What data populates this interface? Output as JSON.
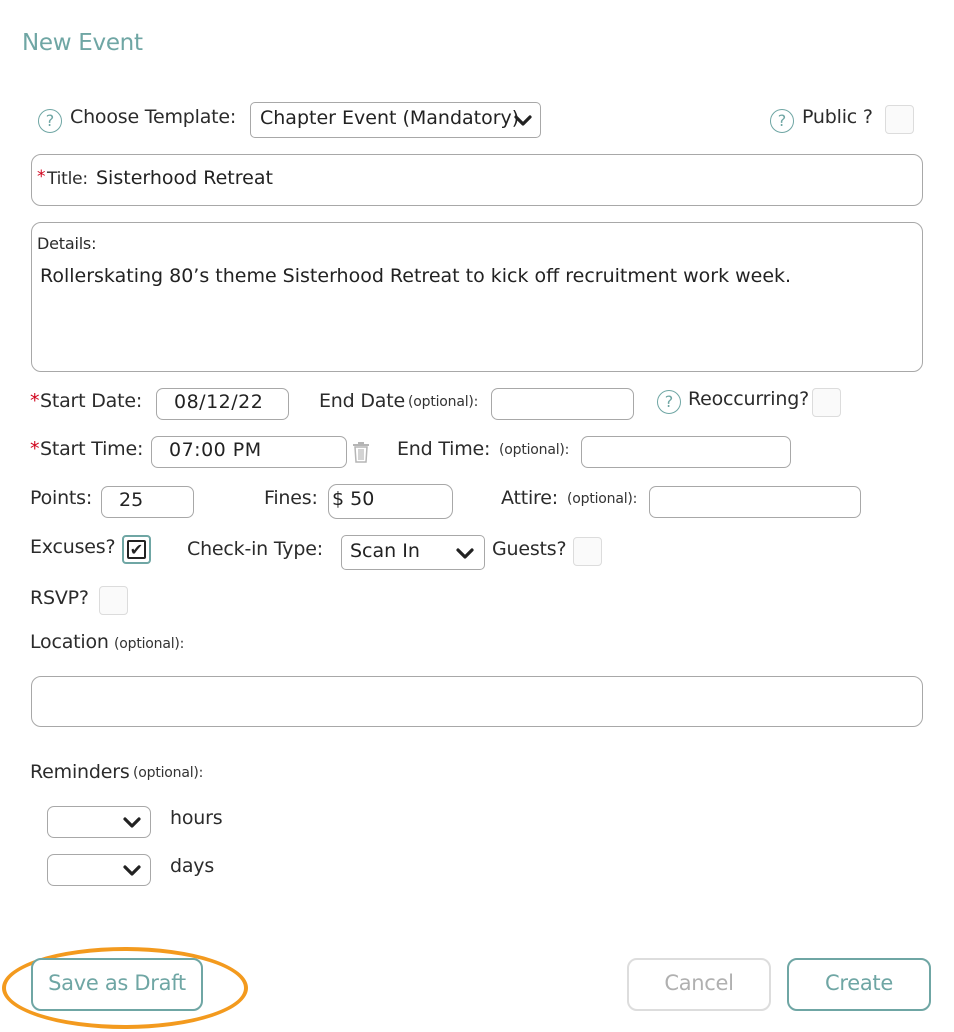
{
  "page": {
    "title": "New Event"
  },
  "template": {
    "label": "Choose Template:",
    "value": "Chapter Event (Mandatory)"
  },
  "public": {
    "label": "Public ?",
    "checked": false
  },
  "title_field": {
    "required_mark": "*",
    "label": "Title:",
    "value": "Sisterhood Retreat"
  },
  "details": {
    "label": "Details:",
    "value": "Rollerskating 80’s theme Sisterhood Retreat to kick off recruitment work week."
  },
  "start_date": {
    "required_mark": "*",
    "label": "Start Date:",
    "value": "08/12/22"
  },
  "end_date": {
    "label": "End Date",
    "optional": "(optional):",
    "value": ""
  },
  "reoccurring": {
    "label": "Reoccurring?",
    "checked": false
  },
  "start_time": {
    "required_mark": "*",
    "label": "Start Time:",
    "value": "07:00 PM"
  },
  "end_time": {
    "label": "End Time:",
    "optional": "(optional):",
    "value": ""
  },
  "points": {
    "label": "Points:",
    "value": "25"
  },
  "fines": {
    "label": "Fines:",
    "value": "$ 50"
  },
  "attire": {
    "label": "Attire:",
    "optional": "(optional):",
    "value": ""
  },
  "excuses": {
    "label": "Excuses?",
    "checked": true,
    "check_glyph": "✔"
  },
  "checkin": {
    "label": "Check-in Type:",
    "value": "Scan In"
  },
  "guests": {
    "label": "Guests?",
    "checked": false
  },
  "rsvp": {
    "label": "RSVP?",
    "checked": false
  },
  "location": {
    "label": "Location",
    "optional": "(optional):",
    "value": ""
  },
  "reminders": {
    "label": "Reminders",
    "optional": "(optional):",
    "hours_label": "hours",
    "days_label": "days",
    "hours_value": "",
    "days_value": ""
  },
  "help_glyph": "?",
  "buttons": {
    "save_draft": "Save as Draft",
    "cancel": "Cancel",
    "create": "Create"
  },
  "colors": {
    "accent": "#6fa6a4",
    "required": "#d0021b",
    "highlight": "#f39a1e"
  }
}
